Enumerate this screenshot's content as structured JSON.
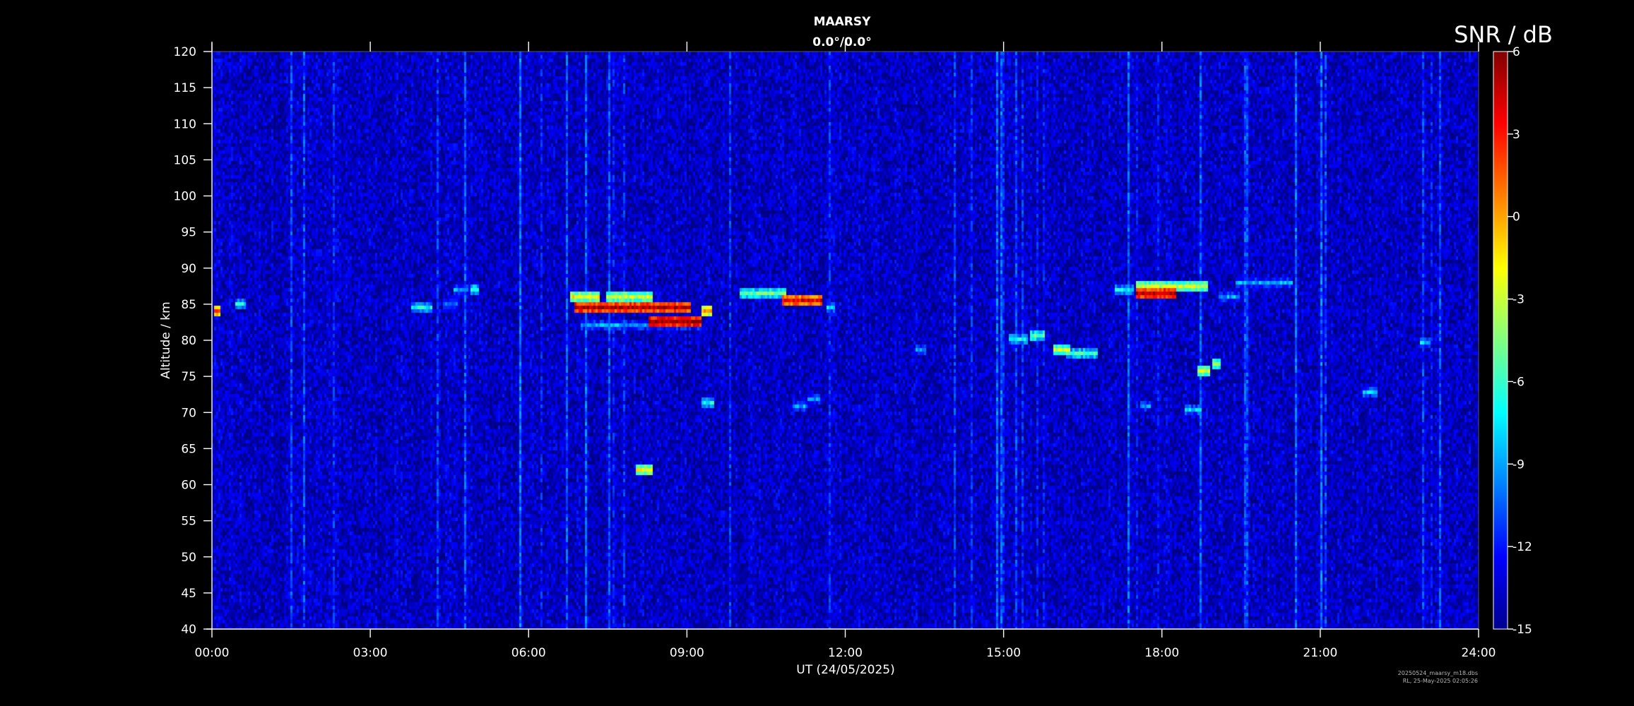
{
  "chart_data": {
    "type": "heatmap",
    "title": "MAARSY",
    "subtitle": "0.0°/0.0°",
    "xlabel": "UT (24/05/2025)",
    "ylabel": "Altitude / km",
    "colorbar_label": "SNR / dB",
    "x_ticks": [
      "00:00",
      "03:00",
      "06:00",
      "09:00",
      "12:00",
      "15:00",
      "18:00",
      "21:00",
      "24:00"
    ],
    "xlim_hours": [
      0,
      24
    ],
    "y_ticks": [
      40,
      45,
      50,
      55,
      60,
      65,
      70,
      75,
      80,
      85,
      90,
      95,
      100,
      105,
      110,
      115,
      120
    ],
    "ylim_km": [
      40,
      120
    ],
    "colorbar_ticks": [
      6,
      3,
      0,
      -3,
      -6,
      -9,
      -12,
      -15
    ],
    "clim_db": [
      -15,
      6
    ],
    "colormap": "jet",
    "background_snr_db": -14,
    "echo_regions": [
      {
        "x_start": 0.05,
        "x_end": 0.1,
        "alt_km": 84.2,
        "snr_db": 2
      },
      {
        "x_start": 0.45,
        "x_end": 0.6,
        "alt_km": 85.3,
        "snr_db": -7
      },
      {
        "x_start": 3.8,
        "x_end": 4.1,
        "alt_km": 84.8,
        "snr_db": -7
      },
      {
        "x_start": 4.4,
        "x_end": 4.6,
        "alt_km": 85.5,
        "snr_db": -10
      },
      {
        "x_start": 4.6,
        "x_end": 4.8,
        "alt_km": 87.2,
        "snr_db": -9
      },
      {
        "x_start": 4.9,
        "x_end": 5.0,
        "alt_km": 87.5,
        "snr_db": -6
      },
      {
        "x_start": 6.8,
        "x_end": 7.3,
        "alt_km": 86.5,
        "snr_db": -2
      },
      {
        "x_start": 6.9,
        "x_end": 9.0,
        "alt_km": 85.0,
        "snr_db": 5
      },
      {
        "x_start": 7.5,
        "x_end": 8.3,
        "alt_km": 86.5,
        "snr_db": -3
      },
      {
        "x_start": 8.3,
        "x_end": 9.2,
        "alt_km": 83.0,
        "snr_db": 6
      },
      {
        "x_start": 7.0,
        "x_end": 9.2,
        "alt_km": 82.2,
        "snr_db": -9
      },
      {
        "x_start": 9.3,
        "x_end": 9.4,
        "alt_km": 84.5,
        "snr_db": 0
      },
      {
        "x_start": 10.0,
        "x_end": 10.8,
        "alt_km": 86.8,
        "snr_db": -5
      },
      {
        "x_start": 10.8,
        "x_end": 11.5,
        "alt_km": 86.0,
        "snr_db": 4
      },
      {
        "x_start": 11.65,
        "x_end": 11.75,
        "alt_km": 84.8,
        "snr_db": -8
      },
      {
        "x_start": 8.05,
        "x_end": 8.3,
        "alt_km": 62.3,
        "snr_db": -2
      },
      {
        "x_start": 9.3,
        "x_end": 9.45,
        "alt_km": 71.8,
        "snr_db": -7
      },
      {
        "x_start": 11.0,
        "x_end": 11.2,
        "alt_km": 71.3,
        "snr_db": -9
      },
      {
        "x_start": 11.3,
        "x_end": 11.45,
        "alt_km": 72.3,
        "snr_db": -9
      },
      {
        "x_start": 15.1,
        "x_end": 15.4,
        "alt_km": 80.5,
        "snr_db": -7
      },
      {
        "x_start": 15.5,
        "x_end": 15.7,
        "alt_km": 80.8,
        "snr_db": -5
      },
      {
        "x_start": 15.95,
        "x_end": 16.2,
        "alt_km": 78.8,
        "snr_db": -3
      },
      {
        "x_start": 16.2,
        "x_end": 16.7,
        "alt_km": 78.3,
        "snr_db": -6
      },
      {
        "x_start": 17.1,
        "x_end": 17.4,
        "alt_km": 87.3,
        "snr_db": -7
      },
      {
        "x_start": 17.5,
        "x_end": 18.2,
        "alt_km": 86.8,
        "snr_db": 5
      },
      {
        "x_start": 17.5,
        "x_end": 18.8,
        "alt_km": 87.6,
        "snr_db": -3
      },
      {
        "x_start": 19.1,
        "x_end": 19.4,
        "alt_km": 86.5,
        "snr_db": -9
      },
      {
        "x_start": 19.4,
        "x_end": 20.4,
        "alt_km": 88.2,
        "snr_db": -9
      },
      {
        "x_start": 17.6,
        "x_end": 17.7,
        "alt_km": 71.0,
        "snr_db": -9
      },
      {
        "x_start": 18.45,
        "x_end": 18.7,
        "alt_km": 70.7,
        "snr_db": -8
      },
      {
        "x_start": 18.95,
        "x_end": 19.05,
        "alt_km": 77.0,
        "snr_db": -4
      },
      {
        "x_start": 18.7,
        "x_end": 18.85,
        "alt_km": 76.0,
        "snr_db": -3
      },
      {
        "x_start": 21.8,
        "x_end": 22.0,
        "alt_km": 73.3,
        "snr_db": -8
      },
      {
        "x_start": 13.35,
        "x_end": 13.45,
        "alt_km": 79.0,
        "snr_db": -9
      },
      {
        "x_start": 22.9,
        "x_end": 23.0,
        "alt_km": 80.0,
        "snr_db": -8
      }
    ]
  },
  "footer": {
    "file_name": "20250524_maarsy_m18.dbs",
    "created": "RL, 25-May-2025 02:05:26"
  }
}
